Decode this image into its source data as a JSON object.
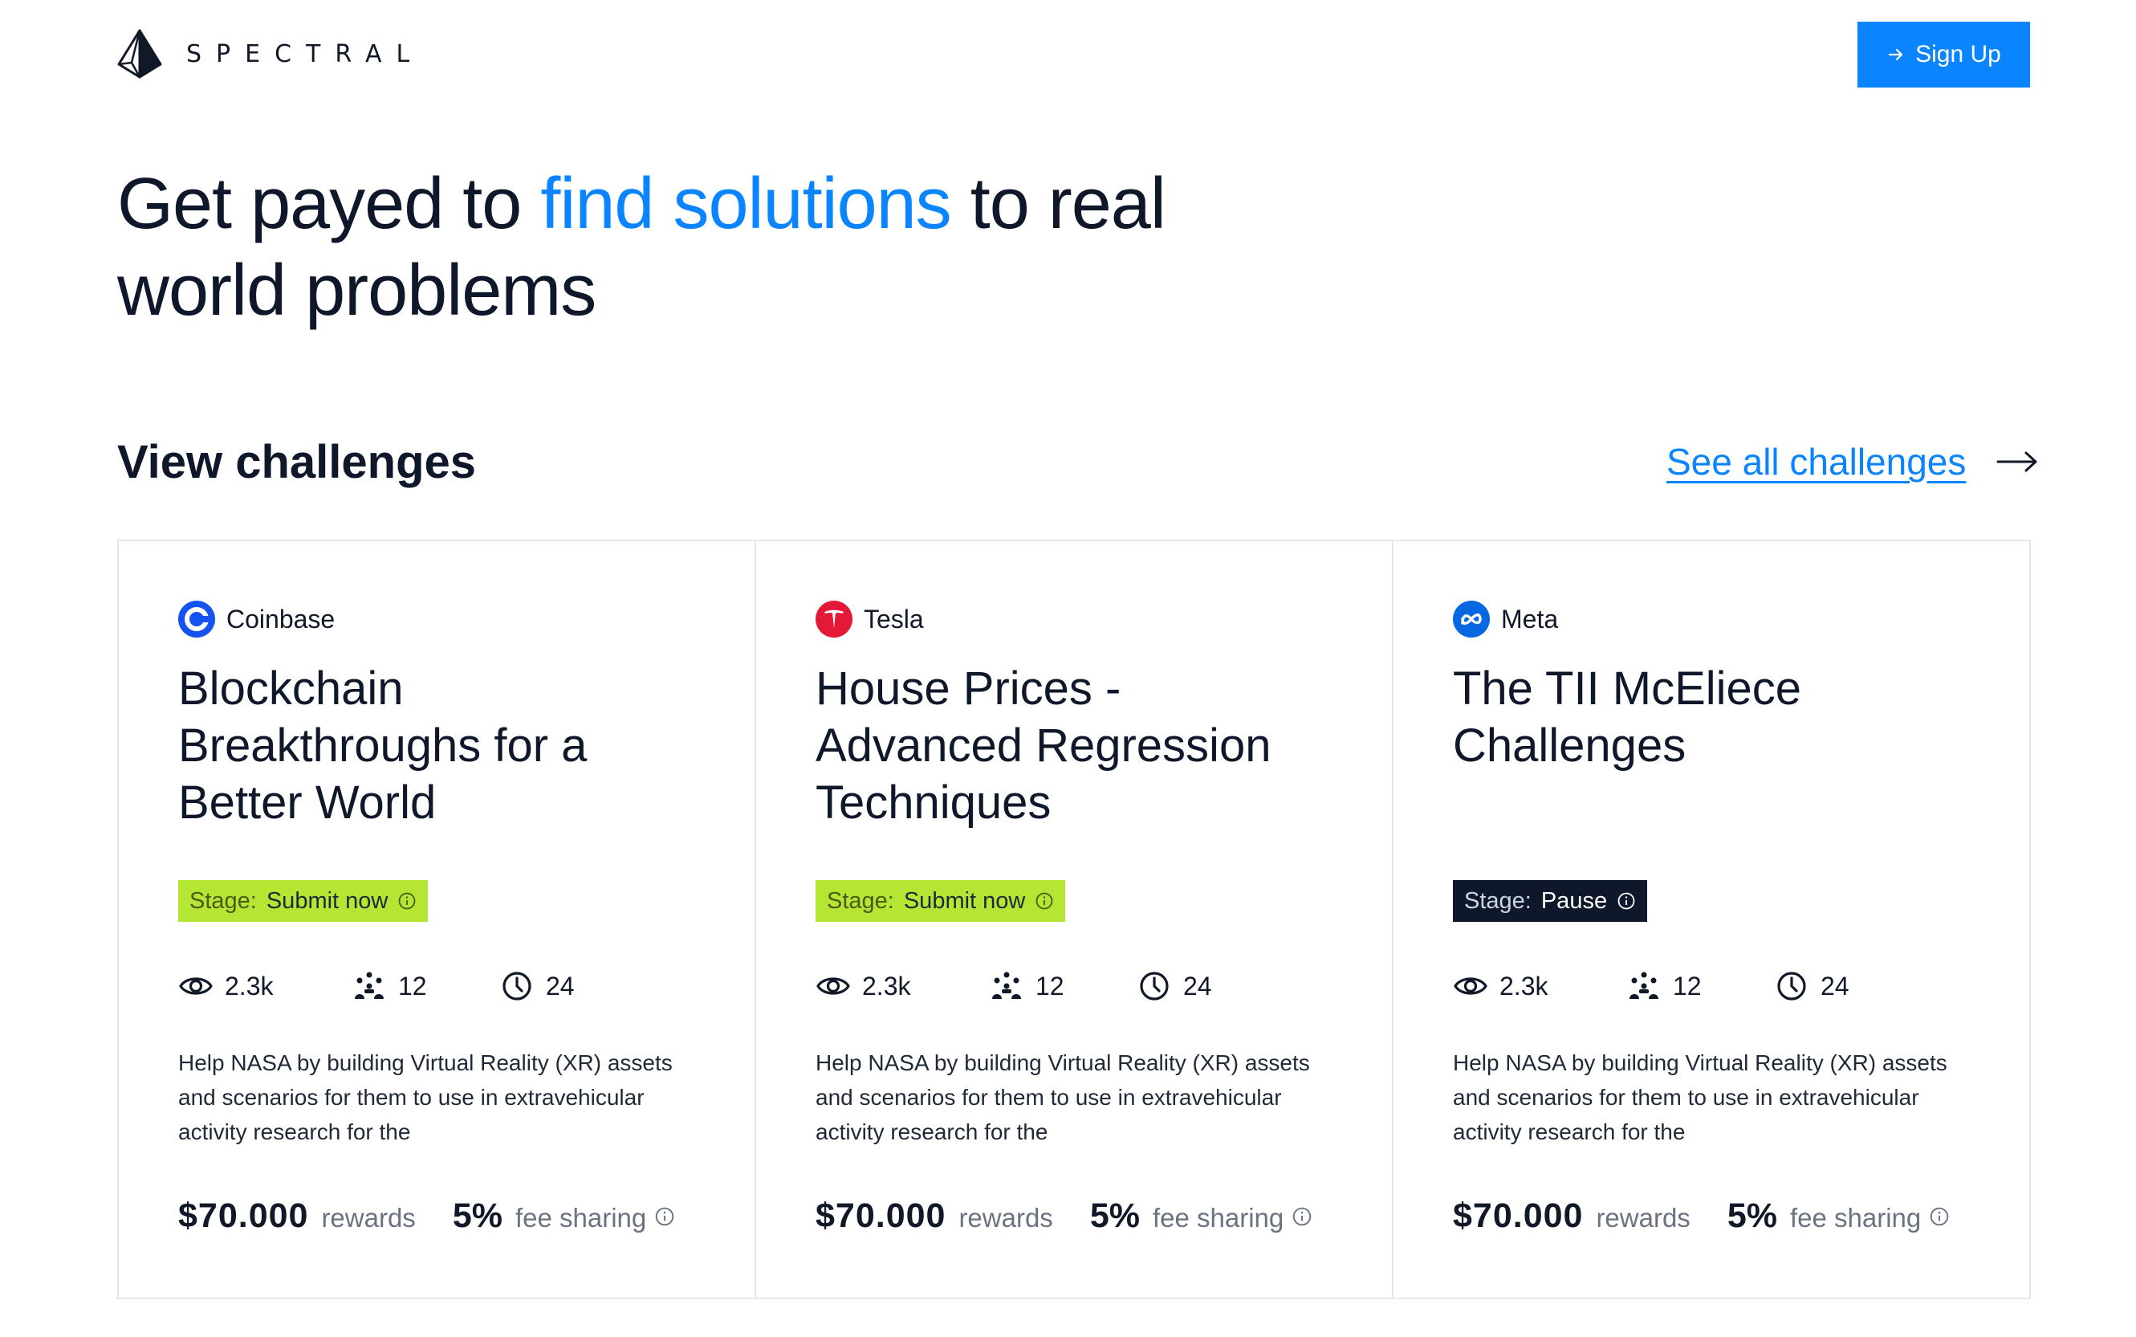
{
  "header": {
    "brand": "SPECTRAL",
    "signup_label": "Sign Up"
  },
  "hero": {
    "before": "Get payed to ",
    "accent": "find solutions",
    "after": " to real world problems"
  },
  "challenges": {
    "section_title": "View challenges",
    "see_all_label": "See all challenges",
    "cards": [
      {
        "company": "Coinbase",
        "title": "Blockchain Breakthroughs for a Better World",
        "stage_label": "Stage:",
        "stage_value": "Submit now",
        "views": "2.3k",
        "participants": "12",
        "days": "24",
        "description": "Help NASA by building Virtual Reality (XR) assets and scenarios for them to use in extravehicular activity research for the",
        "reward_amount": "$70.000",
        "reward_label": "rewards",
        "fee_pct": "5%",
        "fee_label": "fee sharing"
      },
      {
        "company": "Tesla",
        "title": "House Prices - Advanced Regression Techniques",
        "stage_label": "Stage:",
        "stage_value": "Submit now",
        "views": "2.3k",
        "participants": "12",
        "days": "24",
        "description": "Help NASA by building Virtual Reality (XR) assets and scenarios for them to use in extravehicular activity research for the",
        "reward_amount": "$70.000",
        "reward_label": "rewards",
        "fee_pct": "5%",
        "fee_label": "fee sharing"
      },
      {
        "company": "Meta",
        "title": "The TII McEliece Challenges",
        "stage_label": "Stage:",
        "stage_value": "Pause",
        "views": "2.3k",
        "participants": "12",
        "days": "24",
        "description": "Help NASA by building Virtual Reality (XR) assets and scenarios for them to use in extravehicular activity research for the",
        "reward_amount": "$70.000",
        "reward_label": "rewards",
        "fee_pct": "5%",
        "fee_label": "fee sharing"
      }
    ]
  },
  "colors": {
    "accent": "#0a84ff",
    "stage_active": "#b6e634",
    "stage_paused": "#0f172a",
    "coinbase": "#1652f0",
    "tesla": "#e31937",
    "meta": "#0668e1"
  },
  "icons": {
    "logo": "pyramid-logo-icon",
    "signup": "arrow-right-icon",
    "see_all": "long-arrow-right-icon",
    "views": "eye-icon",
    "participants": "people-icon",
    "days": "clock-icon",
    "info": "info-icon"
  }
}
